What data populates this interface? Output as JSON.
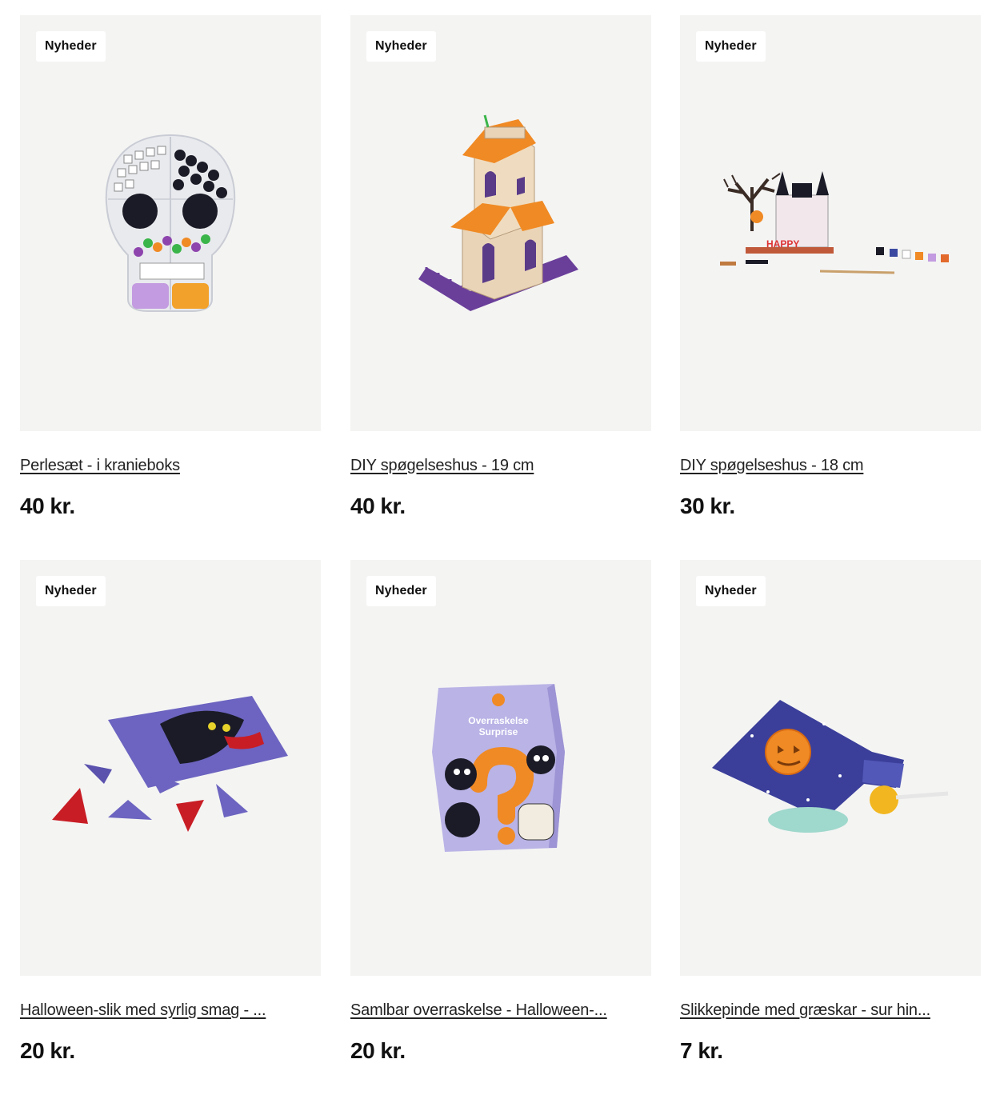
{
  "products": [
    {
      "badge": "Nyheder",
      "title": "Perlesæt - i kranieboks",
      "price": "40 kr.",
      "image_icon": "skull-bead-box-icon"
    },
    {
      "badge": "Nyheder",
      "title": "DIY spøgelseshus - 19 cm",
      "price": "40 kr.",
      "image_icon": "wooden-haunted-house-icon"
    },
    {
      "badge": "Nyheder",
      "title": "DIY spøgelseshus - 18 cm",
      "price": "30 kr.",
      "image_icon": "halloween-diorama-icon"
    },
    {
      "badge": "Nyheder",
      "title": "Halloween-slik med syrlig smag - ...",
      "price": "20 kr.",
      "image_icon": "candy-bag-icon"
    },
    {
      "badge": "Nyheder",
      "title": "Samlbar overraskelse - Halloween-...",
      "price": "20 kr.",
      "image_icon": "surprise-box-icon"
    },
    {
      "badge": "Nyheder",
      "title": "Slikkepinde med græskar - sur hin...",
      "price": "7 kr.",
      "image_icon": "lollipop-pouch-icon"
    }
  ],
  "colors": {
    "card_bg": "#f4f4f3",
    "badge_bg": "#ffffff",
    "text": "#111111",
    "purple": "#7b6cc9",
    "orange": "#f08a24"
  }
}
